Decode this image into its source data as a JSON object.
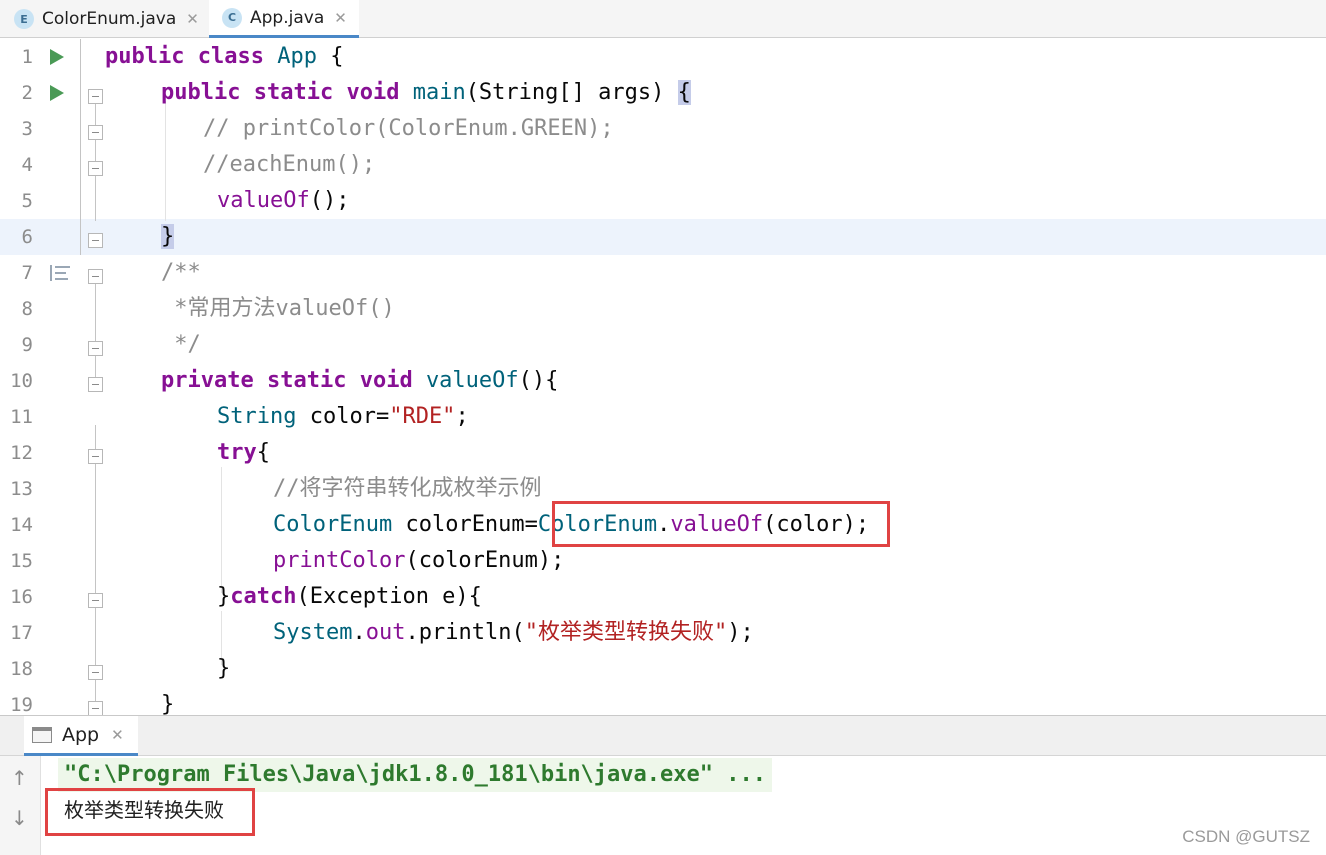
{
  "tabs": [
    {
      "label": "ColorEnum.java",
      "icon": "enum-file-icon",
      "icon_letter": "E",
      "active": false
    },
    {
      "label": "App.java",
      "icon": "class-file-icon",
      "icon_letter": "C",
      "active": true
    }
  ],
  "editor": {
    "line_numbers": [
      "1",
      "2",
      "3",
      "4",
      "5",
      "6",
      "7",
      "8",
      "9",
      "10",
      "11",
      "12",
      "13",
      "14",
      "15",
      "16",
      "17",
      "18",
      "19"
    ],
    "tokens": {
      "l1_public": "public",
      "l1_class": "class",
      "l1_name": "App",
      "l1_brace": "{",
      "l2_public": "public",
      "l2_static": "static",
      "l2_void": "void",
      "l2_main": "main",
      "l2_params": "(String[] args) ",
      "l2_brace": "{",
      "l3": "// printColor(ColorEnum.GREEN);",
      "l4": "//eachEnum();",
      "l5_call": "valueOf",
      "l5_rest": "();",
      "l6_brace": "}",
      "l7": "/**",
      "l8": " *常用方法valueOf()",
      "l9": " */",
      "l10_private": "private",
      "l10_static": "static",
      "l10_void": "void",
      "l10_name": "valueOf",
      "l10_rest": "(){",
      "l11_type": "String",
      "l11_var": " color=",
      "l11_str": "\"RDE\"",
      "l11_end": ";",
      "l12_try": "try",
      "l12_brace": "{",
      "l13": "//将字符串转化成枚举示例",
      "l14_type": "ColorEnum",
      "l14_var": " colorEnum=",
      "l14_cls": "ColorEnum",
      "l14_dot": ".",
      "l14_call": "valueOf",
      "l14_args": "(color)",
      "l14_end": ";",
      "l15_call": "printColor",
      "l15_rest": "(colorEnum);",
      "l16_close": "}",
      "l16_catch": "catch",
      "l16_rest": "(Exception e){",
      "l17_sys": "System",
      "l17_dot": ".",
      "l17_out": "out",
      "l17_println": ".println(",
      "l17_str": "\"枚举类型转换失败\"",
      "l17_end": ");",
      "l18": "}",
      "l19": "}"
    }
  },
  "run_panel": {
    "tab_label": "App",
    "command": "\"C:\\Program Files\\Java\\jdk1.8.0_181\\bin\\java.exe\" ...",
    "output": "枚举类型转换失败",
    "up_arrow": "↑",
    "down_arrow": "↓"
  },
  "watermark": "CSDN @GUTSZ",
  "colors": {
    "keyword": "#0033b3",
    "method": "#871094",
    "string": "#067d17",
    "comment": "#8c8c8c",
    "highlight_box": "#e04343"
  }
}
